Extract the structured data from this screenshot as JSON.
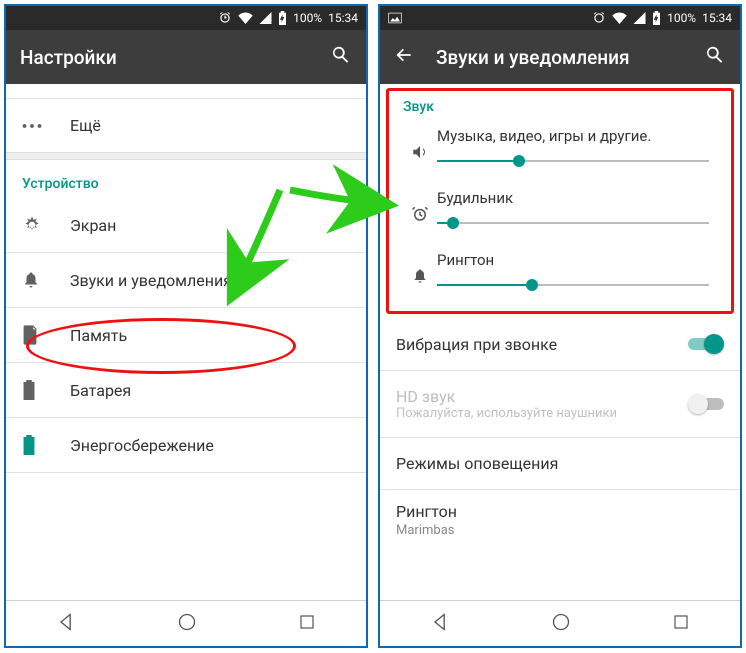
{
  "status": {
    "battery": "100%",
    "time": "15:34"
  },
  "left": {
    "title": "Настройки",
    "more": "Ещё",
    "section": "Устройство",
    "items": {
      "display": "Экран",
      "sound": "Звуки и уведомления",
      "storage": "Память",
      "battery": "Батарея",
      "powersave": "Энергосбережение"
    }
  },
  "right": {
    "title": "Звуки и уведомления",
    "sound_header": "Звук",
    "sliders": {
      "media": {
        "label": "Музыка, видео, игры и другие.",
        "value": 30
      },
      "alarm": {
        "label": "Будильник",
        "value": 6
      },
      "ring": {
        "label": "Рингтон",
        "value": 35
      }
    },
    "vibrate": {
      "label": "Вибрация при звонке",
      "on": true
    },
    "hd": {
      "label": "HD звук",
      "sub": "Пожалуйста, используйте наушники",
      "on": false
    },
    "alert_modes": "Режимы оповещения",
    "ringtone": {
      "label": "Рингтон",
      "value": "Marimbas"
    }
  }
}
